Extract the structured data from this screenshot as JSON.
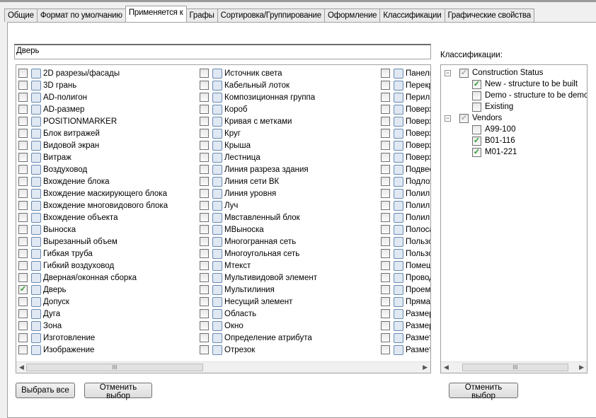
{
  "tabs": [
    "Общие",
    "Формат по умолчанию",
    "Применяется к",
    "Графы",
    "Сортировка/Группирование",
    "Оформление",
    "Классификации",
    "Графические свойства"
  ],
  "active_tab": 2,
  "filter_value": "Дверь",
  "columns": [
    [
      "2D разрезы/фасады",
      "3D грань",
      "AD-полигон",
      "AD-размер",
      "POSITIONMARKER",
      "Блок витражей",
      "Видовой экран",
      "Витраж",
      "Воздуховод",
      "Вхождение блока",
      "Вхождение маскирующего блока",
      "Вхождение многовидового блока",
      "Вхождение объекта",
      "Выноска",
      "Вырезанный объем",
      "Гибкая труба",
      "Гибкий воздуховод",
      "Дверная/оконная сборка",
      "Дверь",
      "Допуск",
      "Дуга",
      "Зона",
      "Изготовление",
      "Изображение"
    ],
    [
      "Источник света",
      "Кабельный лоток",
      "Композиционная группа",
      "Короб",
      "Кривая с метками",
      "Круг",
      "Крыша",
      "Лестница",
      "Линия разреза здания",
      "Линия сети ВК",
      "Линия уровня",
      "Луч",
      "Мвставленный блок",
      "МВыноска",
      "Многогранная сеть",
      "Многоугольная сеть",
      "Мтекст",
      "Мультивидовой элемент",
      "Мультилиния",
      "Несущий элемент",
      "Область",
      "Окно",
      "Определение атрибута",
      "Отрезок"
    ],
    [
      "Панель",
      "Перекр",
      "Перила",
      "Поверх",
      "Поверх",
      "Поверх",
      "Поверх",
      "Поверх",
      "Подвес",
      "Подлож",
      "Полили",
      "Полили",
      "Полили",
      "Полоса",
      "Пользо",
      "Пользо",
      "Помещ",
      "Провод",
      "Проем",
      "Прямая",
      "Размер",
      "Размер",
      "Размет",
      "Размет"
    ]
  ],
  "checked_items": [
    "Дверь"
  ],
  "classifications_label": "Классификации:",
  "tree": [
    {
      "label": "Construction Status",
      "level": 0,
      "checked": "partial",
      "children": [
        {
          "label": "New - structure to be built",
          "checked": true
        },
        {
          "label": "Demo - structure to be demolis",
          "checked": false
        },
        {
          "label": "Existing",
          "checked": false
        }
      ]
    },
    {
      "label": "Vendors",
      "level": 0,
      "checked": "partial",
      "children": [
        {
          "label": "A99-100",
          "checked": false
        },
        {
          "label": "B01-116",
          "checked": true
        },
        {
          "label": "M01-221",
          "checked": true
        }
      ]
    }
  ],
  "buttons": {
    "select_all": "Выбрать все",
    "clear": "Отменить выбор",
    "clear_class": "Отменить выбор"
  },
  "scroll_thumb": "III"
}
